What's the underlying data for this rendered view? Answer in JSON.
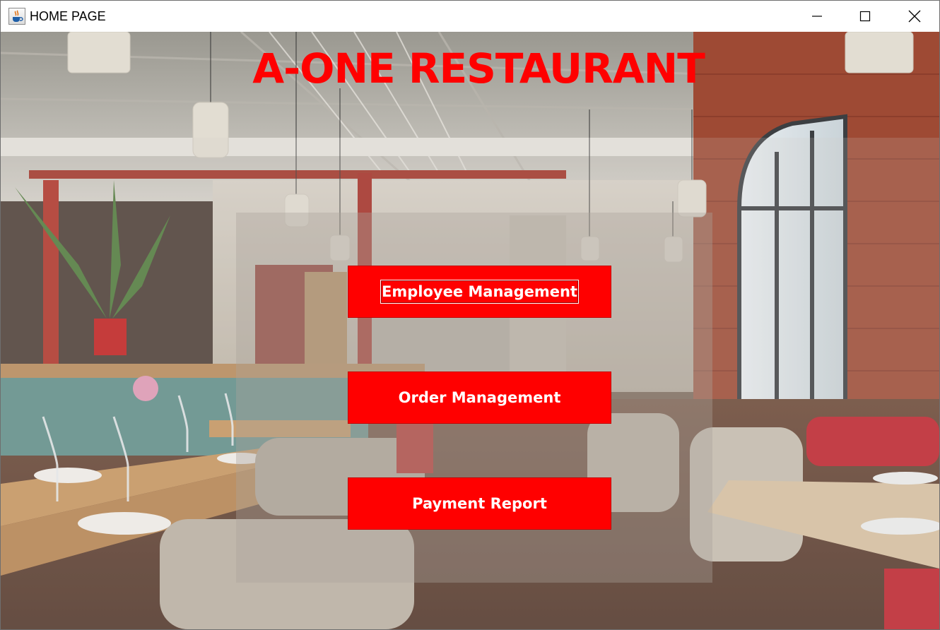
{
  "window": {
    "title": "HOME PAGE",
    "app_icon": "java-coffee-cup-icon",
    "controls": [
      "minimize-icon",
      "maximize-icon",
      "close-icon"
    ]
  },
  "main": {
    "heading": "A-ONE RESTAURANT",
    "buttons": [
      {
        "label": "Employee Management",
        "focused": true
      },
      {
        "label": "Order Management",
        "focused": false
      },
      {
        "label": "Payment Report",
        "focused": false
      }
    ]
  },
  "colors": {
    "accent": "#ff0000",
    "button_text": "#ffffff"
  }
}
